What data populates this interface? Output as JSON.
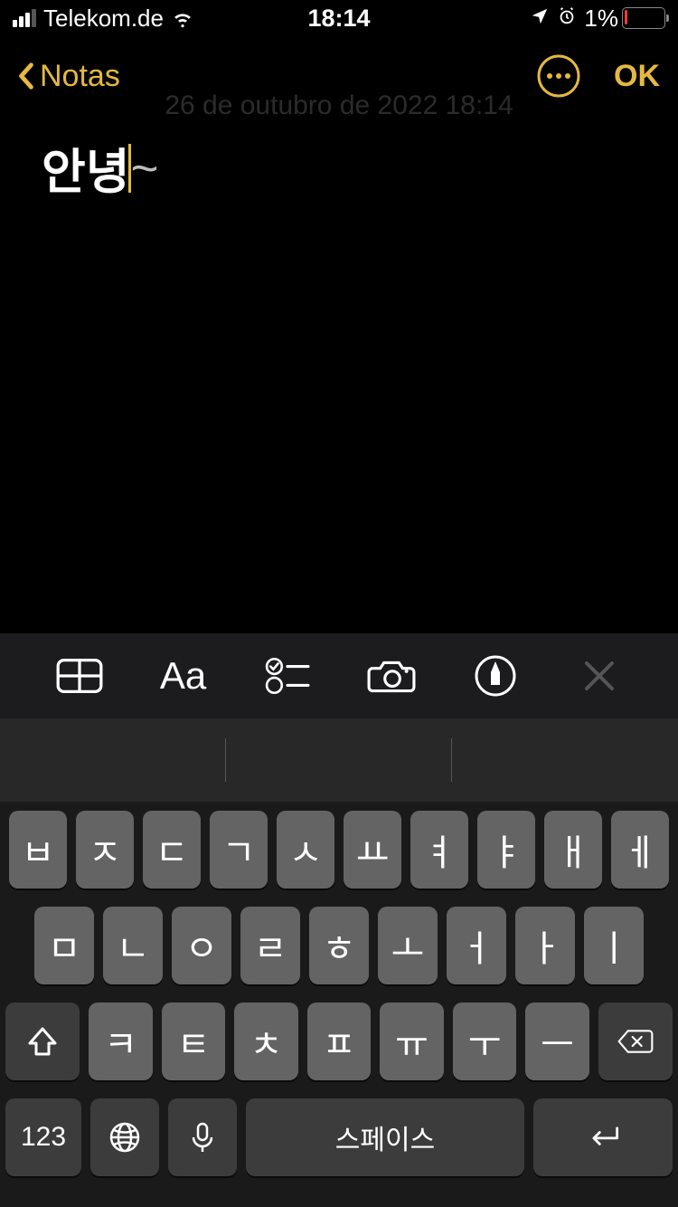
{
  "status": {
    "carrier": "Telekom.de",
    "time": "18:14",
    "battery_percent": "1%"
  },
  "nav": {
    "back_label": "Notas",
    "ok_label": "OK",
    "date": "26 de outubro de 2022 18:14"
  },
  "note": {
    "text_before_cursor": "안녕",
    "text_after_cursor": "~"
  },
  "keyboard": {
    "row1": [
      "ㅂ",
      "ㅈ",
      "ㄷ",
      "ㄱ",
      "ㅅ",
      "ㅛ",
      "ㅕ",
      "ㅑ",
      "ㅐ",
      "ㅔ"
    ],
    "row2": [
      "ㅁ",
      "ㄴ",
      "ㅇ",
      "ㄹ",
      "ㅎ",
      "ㅗ",
      "ㅓ",
      "ㅏ",
      "ㅣ"
    ],
    "row3": [
      "ㅋ",
      "ㅌ",
      "ㅊ",
      "ㅍ",
      "ㅠ",
      "ㅜ",
      "ㅡ"
    ],
    "num_label": "123",
    "space_label": "스페이스"
  }
}
